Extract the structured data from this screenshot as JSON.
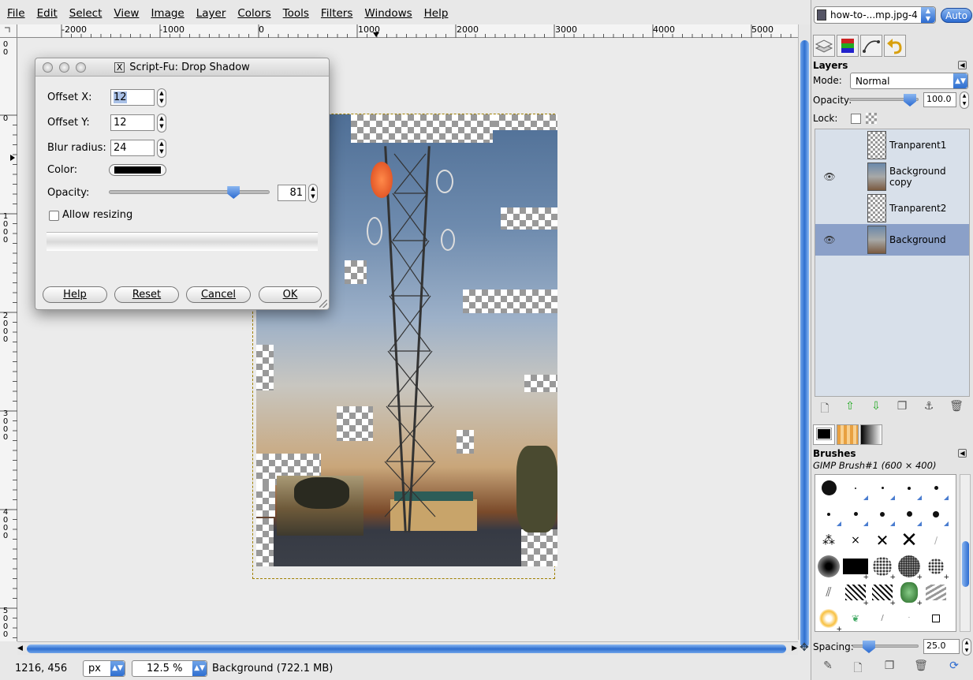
{
  "menu": {
    "items": [
      "File",
      "Edit",
      "Select",
      "View",
      "Image",
      "Layer",
      "Colors",
      "Tools",
      "Filters",
      "Windows",
      "Help"
    ]
  },
  "rulers": {
    "horizontal": [
      "-2000",
      "-1000",
      "0",
      "1000",
      "2000",
      "3000",
      "4000",
      "5000"
    ],
    "vertical": [
      [
        "0",
        "0"
      ],
      [
        "0"
      ],
      [
        "1",
        "0",
        "0",
        "0"
      ],
      [
        "2",
        "0",
        "0",
        "0"
      ],
      [
        "3",
        "0",
        "0",
        "0"
      ],
      [
        "4",
        "0",
        "0",
        "0"
      ],
      [
        "5",
        "0",
        "0",
        "0"
      ]
    ]
  },
  "dialog": {
    "title": "Script-Fu: Drop Shadow",
    "offset_x": {
      "label": "Offset X:",
      "value": "12"
    },
    "offset_y": {
      "label": "Offset Y:",
      "value": "12"
    },
    "blur_radius": {
      "label": "Blur radius:",
      "value": "24"
    },
    "color": {
      "label": "Color:",
      "value": "#000000"
    },
    "opacity": {
      "label": "Opacity:",
      "value": "81",
      "fraction": 0.81
    },
    "allow_resizing": {
      "label": "Allow resizing",
      "checked": false
    },
    "buttons": {
      "help": "Help",
      "reset": "Reset",
      "cancel": "Cancel",
      "ok": "OK"
    }
  },
  "status": {
    "coords": "1216, 456",
    "unit": "px",
    "zoom": "12.5 %",
    "info": "Background (722.1 MB)"
  },
  "dock": {
    "image_select": "how-to-...mp.jpg-4",
    "auto_label": "Auto",
    "layers": {
      "title": "Layers",
      "mode_label": "Mode:",
      "mode_value": "Normal",
      "opacity_label": "Opacity:",
      "opacity_value": "100.0",
      "lock_label": "Lock:",
      "items": [
        {
          "name": "Tranparent1",
          "visible": false,
          "selected": false
        },
        {
          "name": "Background copy",
          "visible": true,
          "selected": false
        },
        {
          "name": "Tranparent2",
          "visible": false,
          "selected": false
        },
        {
          "name": "Background",
          "visible": true,
          "selected": true
        }
      ]
    },
    "brushes": {
      "title": "Brushes",
      "current": "GIMP Brush#1 (600 × 400)",
      "spacing_label": "Spacing:",
      "spacing_value": "25.0"
    }
  },
  "icons": {
    "eye": "eye-icon",
    "accent": "#2f6fd0",
    "selection": "#8ba0c8"
  }
}
